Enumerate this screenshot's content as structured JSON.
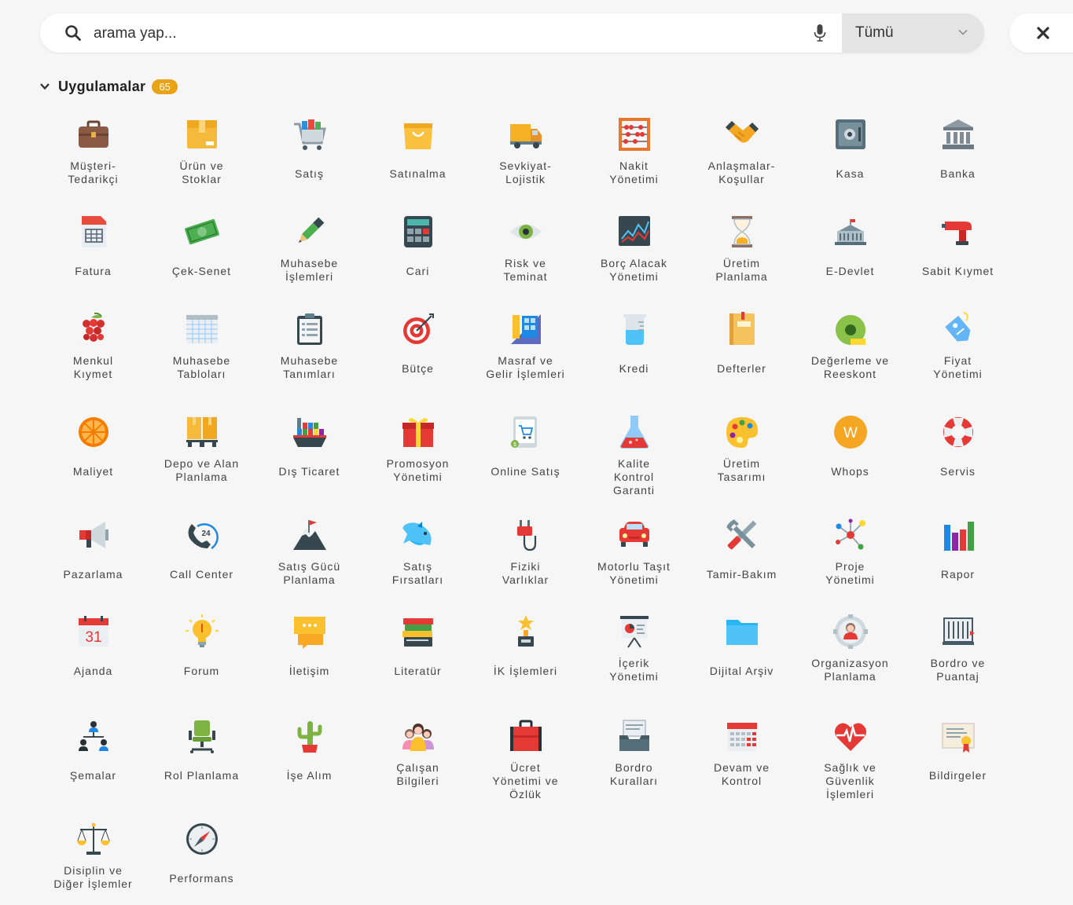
{
  "search": {
    "placeholder": "arama yap...",
    "filter_value": "Tümü"
  },
  "section": {
    "title": "Uygulamalar",
    "count": "65"
  },
  "apps": [
    {
      "label": "Müşteri-\nTedarikçi",
      "icon": "briefcase-icon"
    },
    {
      "label": "Ürün ve\nStoklar",
      "icon": "box-icon"
    },
    {
      "label": "Satış",
      "icon": "cart-icon"
    },
    {
      "label": "Satınalma",
      "icon": "shopping-bag-icon"
    },
    {
      "label": "Sevkiyat-\nLojistik",
      "icon": "truck-icon"
    },
    {
      "label": "Nakit\nYönetimi",
      "icon": "abacus-icon"
    },
    {
      "label": "Anlaşmalar-\nKoşullar",
      "icon": "handshake-icon"
    },
    {
      "label": "Kasa",
      "icon": "safe-icon"
    },
    {
      "label": "Banka",
      "icon": "bank-icon"
    },
    {
      "label": "Fatura",
      "icon": "invoice-icon"
    },
    {
      "label": "Çek-Senet",
      "icon": "banknote-icon"
    },
    {
      "label": "Muhasebe\nİşlemleri",
      "icon": "pen-icon"
    },
    {
      "label": "Cari",
      "icon": "calculator-icon"
    },
    {
      "label": "Risk ve\nTeminat",
      "icon": "eye-icon"
    },
    {
      "label": "Borç Alacak\nYönetimi",
      "icon": "chart-board-icon"
    },
    {
      "label": "Üretim\nPlanlama",
      "icon": "hourglass-icon"
    },
    {
      "label": "E-Devlet",
      "icon": "government-building-icon"
    },
    {
      "label": "Sabit Kıymet",
      "icon": "drill-icon"
    },
    {
      "label": "Menkul\nKıymet",
      "icon": "grapes-icon"
    },
    {
      "label": "Muhasebe\nTabloları",
      "icon": "spreadsheet-icon"
    },
    {
      "label": "Muhasebe\nTanımları",
      "icon": "clipboard-icon"
    },
    {
      "label": "Bütçe",
      "icon": "target-icon"
    },
    {
      "label": "Masraf ve\nGelir İşlemleri",
      "icon": "tools-ruler-icon"
    },
    {
      "label": "Kredi",
      "icon": "beaker-icon"
    },
    {
      "label": "Defterler",
      "icon": "notebook-icon"
    },
    {
      "label": "Değerleme ve\nReeskont",
      "icon": "tape-measure-icon"
    },
    {
      "label": "Fiyat\nYönetimi",
      "icon": "price-tag-icon"
    },
    {
      "label": "Maliyet",
      "icon": "orange-slice-icon"
    },
    {
      "label": "Depo ve Alan\nPlanlama",
      "icon": "pallet-icon"
    },
    {
      "label": "Dış Ticaret",
      "icon": "cargo-ship-icon"
    },
    {
      "label": "Promosyon\nYönetimi",
      "icon": "gift-icon"
    },
    {
      "label": "Online Satış",
      "icon": "tablet-cart-icon"
    },
    {
      "label": "Kalite\nKontrol\nGaranti",
      "icon": "flask-icon"
    },
    {
      "label": "Üretim\nTasarımı",
      "icon": "palette-icon"
    },
    {
      "label": "Whops",
      "icon": "whops-logo-icon"
    },
    {
      "label": "Servis",
      "icon": "lifebuoy-icon"
    },
    {
      "label": "Pazarlama",
      "icon": "megaphone-icon"
    },
    {
      "label": "Call Center",
      "icon": "phone-24-icon"
    },
    {
      "label": "Satış Gücü\nPlanlama",
      "icon": "mountain-flag-icon"
    },
    {
      "label": "Satış\nFırsatları",
      "icon": "fish-icon"
    },
    {
      "label": "Fiziki\nVarlıklar",
      "icon": "power-plug-icon"
    },
    {
      "label": "Motorlu Taşıt\nYönetimi",
      "icon": "car-icon"
    },
    {
      "label": "Tamir-Bakım",
      "icon": "wrench-screwdriver-icon"
    },
    {
      "label": "Proje\nYönetimi",
      "icon": "network-nodes-icon"
    },
    {
      "label": "Rapor",
      "icon": "bar-chart-icon"
    },
    {
      "label": "Ajanda",
      "icon": "calendar-icon"
    },
    {
      "label": "Forum",
      "icon": "lightbulb-icon"
    },
    {
      "label": "İletişim",
      "icon": "chat-bubbles-icon"
    },
    {
      "label": "Literatür",
      "icon": "books-icon"
    },
    {
      "label": "İK İşlemleri",
      "icon": "trophy-icon"
    },
    {
      "label": "İçerik\nYönetimi",
      "icon": "presentation-icon"
    },
    {
      "label": "Dijital Arşiv",
      "icon": "folder-icon"
    },
    {
      "label": "Organizasyon\nPlanlama",
      "icon": "person-gear-icon"
    },
    {
      "label": "Bordro ve\nPuantaj",
      "icon": "time-clock-icon"
    },
    {
      "label": "Şemalar",
      "icon": "org-chart-icon"
    },
    {
      "label": "Rol Planlama",
      "icon": "office-chair-icon"
    },
    {
      "label": "İşe Alım",
      "icon": "cactus-icon"
    },
    {
      "label": "Çalışan\nBilgileri",
      "icon": "people-group-icon"
    },
    {
      "label": "Ücret\nYönetimi ve\nÖzlük",
      "icon": "red-briefcase-icon"
    },
    {
      "label": "Bordro\nKuralları",
      "icon": "inbox-tray-icon"
    },
    {
      "label": "Devam ve\nKontrol",
      "icon": "attendance-calendar-icon"
    },
    {
      "label": "Sağlık ve\nGüvenlik\nİşlemleri",
      "icon": "heart-pulse-icon"
    },
    {
      "label": "Bildirgeler",
      "icon": "certificate-icon"
    },
    {
      "label": "Disiplin ve\nDiğer İşlemler",
      "icon": "scales-icon"
    },
    {
      "label": "Performans",
      "icon": "compass-icon"
    }
  ]
}
